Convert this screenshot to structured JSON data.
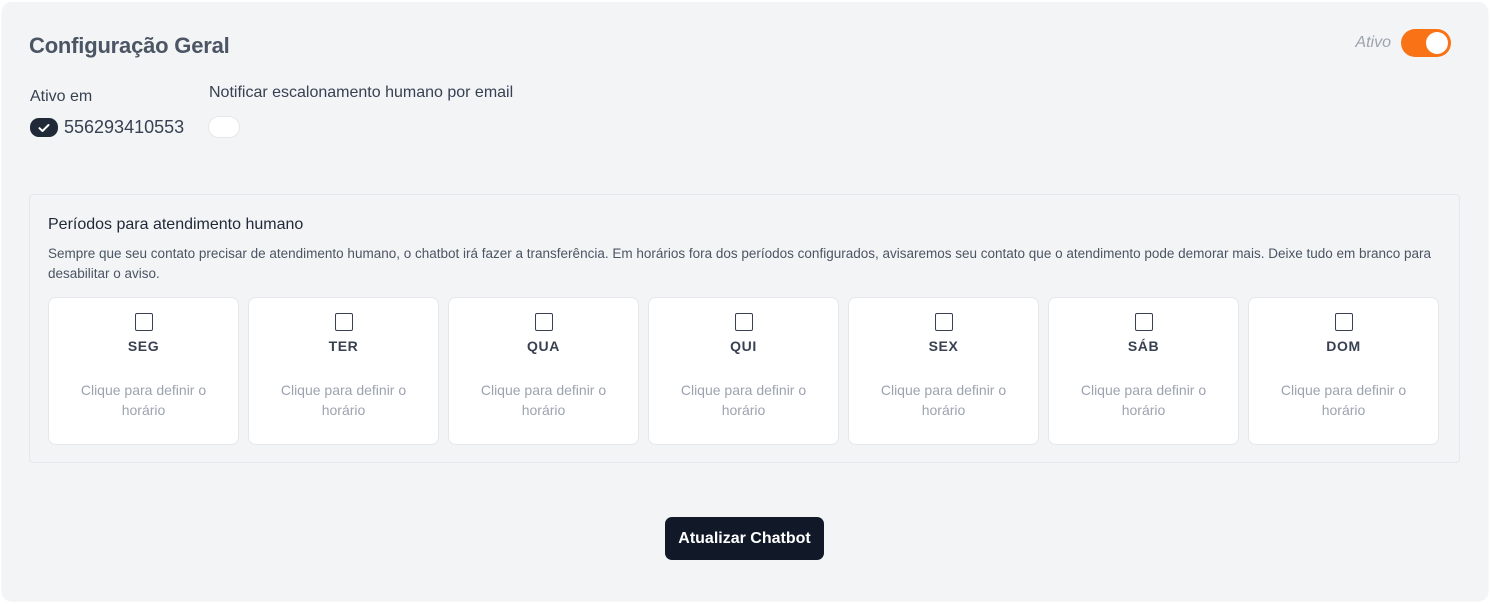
{
  "header": {
    "title": "Configuração Geral",
    "status_label": "Ativo",
    "status_toggle_on": true,
    "accent_color": "#f97316"
  },
  "active_in": {
    "label": "Ativo em",
    "phone": "556293410553",
    "checked": true
  },
  "notify": {
    "label": "Notificar escalonamento humano por email",
    "enabled": false
  },
  "periods": {
    "title": "Períodos para atendimento humano",
    "description": "Sempre que seu contato precisar de atendimento humano, o chatbot irá fazer a transferência. Em horários fora dos períodos configurados, avisaremos seu contato que o atendimento pode demorar mais. Deixe tudo em branco para desabilitar o aviso.",
    "days": [
      {
        "name": "SEG",
        "hint": "Clique para definir o horário",
        "checked": false
      },
      {
        "name": "TER",
        "hint": "Clique para definir o horário",
        "checked": false
      },
      {
        "name": "QUA",
        "hint": "Clique para definir o horário",
        "checked": false
      },
      {
        "name": "QUI",
        "hint": "Clique para definir o horário",
        "checked": false
      },
      {
        "name": "SEX",
        "hint": "Clique para definir o horário",
        "checked": false
      },
      {
        "name": "SÁB",
        "hint": "Clique para definir o horário",
        "checked": false
      },
      {
        "name": "DOM",
        "hint": "Clique para definir o horário",
        "checked": false
      }
    ]
  },
  "actions": {
    "update_label": "Atualizar Chatbot"
  }
}
